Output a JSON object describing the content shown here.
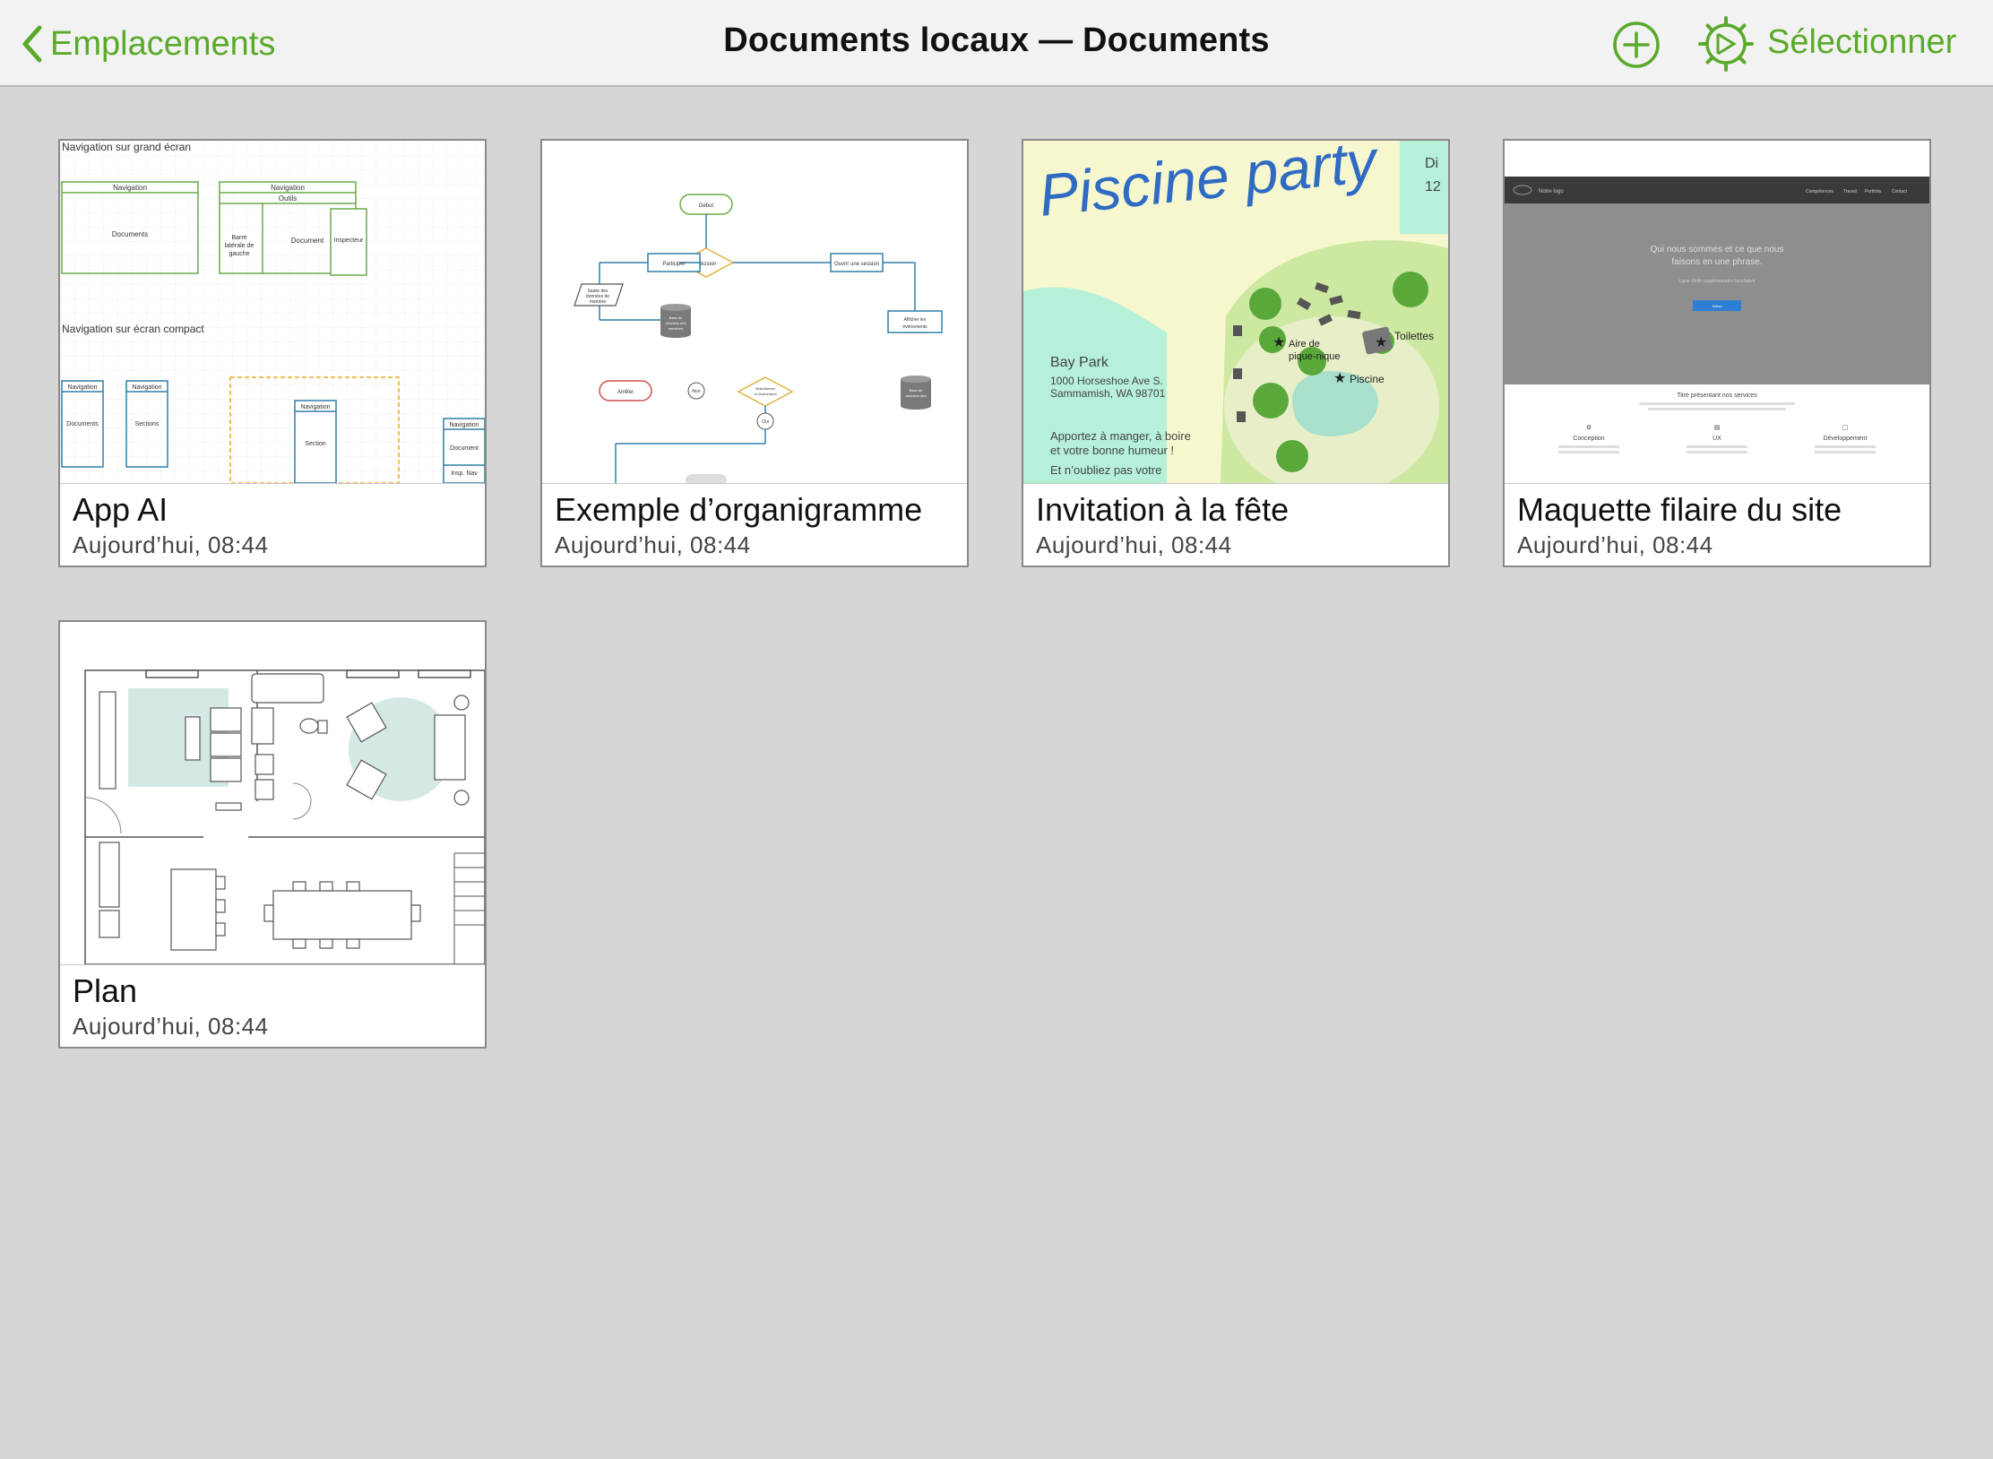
{
  "colors": {
    "accent": "#5aaa2a",
    "background": "#d6d6d6",
    "navbar": "#f2f2f2"
  },
  "navbar": {
    "back_label": "Emplacements",
    "title": "Documents locaux — Documents",
    "select_label": "Sélectionner",
    "icons": [
      "chevron-left-icon",
      "add-circle-icon",
      "settings-gear-icon"
    ]
  },
  "documents": [
    {
      "title": "App AI",
      "date": "Aujourd’hui, 08:44"
    },
    {
      "title": "Exemple d’organigramme",
      "date": "Aujourd’hui, 08:44"
    },
    {
      "title": "Invitation à la fête",
      "date": "Aujourd’hui, 08:44"
    },
    {
      "title": "Maquette filaire du site",
      "date": "Aujourd’hui, 08:44"
    },
    {
      "title": "Plan",
      "date": "Aujourd’hui, 08:44"
    }
  ],
  "thumbnails": {
    "app_ai": {
      "heading_wide": "Navigation sur grand écran",
      "heading_compact": "Navigation sur écran compact",
      "labels": [
        "Navigation",
        "Documents",
        "Outils",
        "Barre latérale de gauche",
        "Document",
        "Inspecteur",
        "Sections",
        "Section",
        "Insp. Nav"
      ]
    },
    "flowchart": {
      "labels": [
        "Début",
        "Participer",
        "Décision",
        "Ouvrir une session",
        "Saisie des données de membre",
        "Base de données des membres",
        "Afficher les événements",
        "Arrêter",
        "Non",
        "Sélectionner un événement",
        "Oui",
        "Base de données des événements"
      ]
    },
    "party": {
      "title": "Piscine party",
      "side_text": "Di",
      "side_number": "12",
      "venue": "Bay Park",
      "address_line1": "1000 Horseshoe Ave S.",
      "address_line2": "Sammamish, WA 98701",
      "note1": "Apportez à manger, à boire",
      "note2": "et votre bonne humeur !",
      "note3": "Et n’oubliez pas votre",
      "map_labels": [
        "Aire de pique-nique",
        "Toilettes",
        "Piscine"
      ]
    },
    "wireframe": {
      "logo": "Notre logo",
      "nav_items": [
        "Compétences",
        "Travail",
        "Portfolio",
        "Contact"
      ],
      "hero_line1": "Qui nous sommes et ce que nous",
      "hero_line2": "faisons en une phrase.",
      "hero_sub": "Ligne d’info supplémentaire facultative",
      "hero_button": "Action",
      "services_title": "Titre présentant nos services",
      "services": [
        "Conception",
        "UX",
        "Développement"
      ]
    }
  }
}
